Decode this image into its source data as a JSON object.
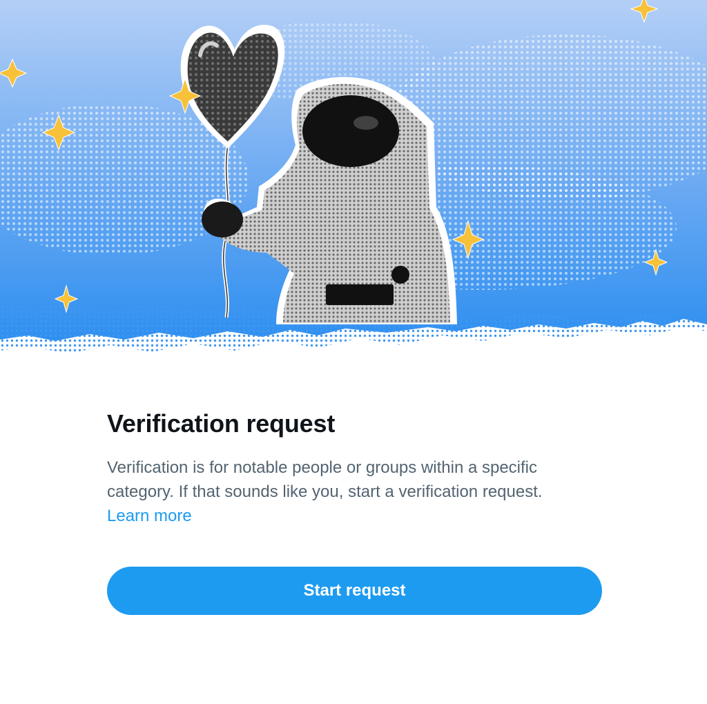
{
  "hero": {
    "illustration": "astronaut-with-heart-balloon",
    "sky_top_color": "#a9c8f5",
    "sky_bottom_color": "#2e8ff0",
    "sparkle_color": "#f7c23a"
  },
  "card": {
    "title": "Verification request",
    "description": "Verification is for notable people or groups within a specific category. If that sounds like you, start a verification request. ",
    "learn_more": "Learn more",
    "start_button": "Start request"
  },
  "colors": {
    "title": "#0f1419",
    "body": "#536471",
    "accent": "#1d9bf0"
  }
}
